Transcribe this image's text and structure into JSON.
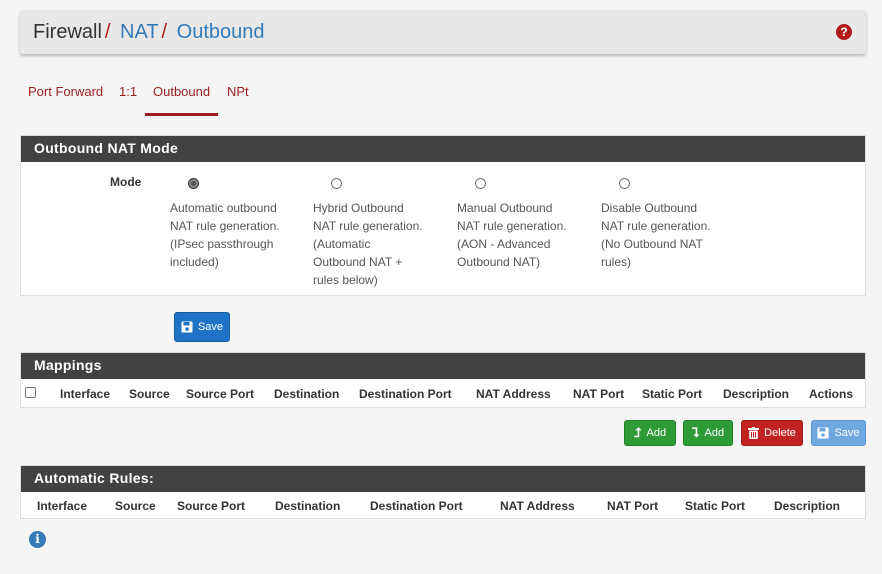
{
  "breadcrumb": {
    "root": "Firewall",
    "sep": "/",
    "nat": "NAT",
    "outbound": "Outbound"
  },
  "help_icon": "question-circle-icon",
  "tabs": [
    {
      "label": "Port Forward",
      "active": false
    },
    {
      "label": "1:1",
      "active": false
    },
    {
      "label": "Outbound",
      "active": true
    },
    {
      "label": "NPt",
      "active": false
    }
  ],
  "mode_panel": {
    "title": "Outbound NAT Mode",
    "label": "Mode",
    "options": [
      {
        "lines": [
          "Automatic outbound",
          "NAT rule generation.",
          "(IPsec passthrough",
          "included)"
        ],
        "checked": true
      },
      {
        "lines": [
          "Hybrid Outbound",
          "NAT rule generation.",
          "(Automatic",
          "Outbound NAT +",
          "rules below)"
        ],
        "checked": false
      },
      {
        "lines": [
          "Manual Outbound",
          "NAT rule generation.",
          "(AON - Advanced",
          "Outbound NAT)"
        ],
        "checked": false
      },
      {
        "lines": [
          "Disable Outbound",
          "NAT rule generation.",
          "(No Outbound NAT",
          "rules)"
        ],
        "checked": false
      }
    ],
    "save_label": "Save"
  },
  "mappings": {
    "title": "Mappings",
    "columns": [
      "Interface",
      "Source",
      "Source Port",
      "Destination",
      "Destination Port",
      "NAT Address",
      "NAT Port",
      "Static Port",
      "Description",
      "Actions"
    ],
    "buttons": {
      "add_top": "Add",
      "add_bottom": "Add",
      "delete": "Delete",
      "save": "Save"
    }
  },
  "automatic_rules": {
    "title": "Automatic Rules:",
    "columns": [
      "Interface",
      "Source",
      "Source Port",
      "Destination",
      "Destination Port",
      "NAT Address",
      "NAT Port",
      "Static Port",
      "Description"
    ]
  },
  "info_icon": "info-circle-icon",
  "colors": {
    "accent_red": "#9a1d1d",
    "link_blue": "#337ab7",
    "panel_heading": "#424242"
  }
}
